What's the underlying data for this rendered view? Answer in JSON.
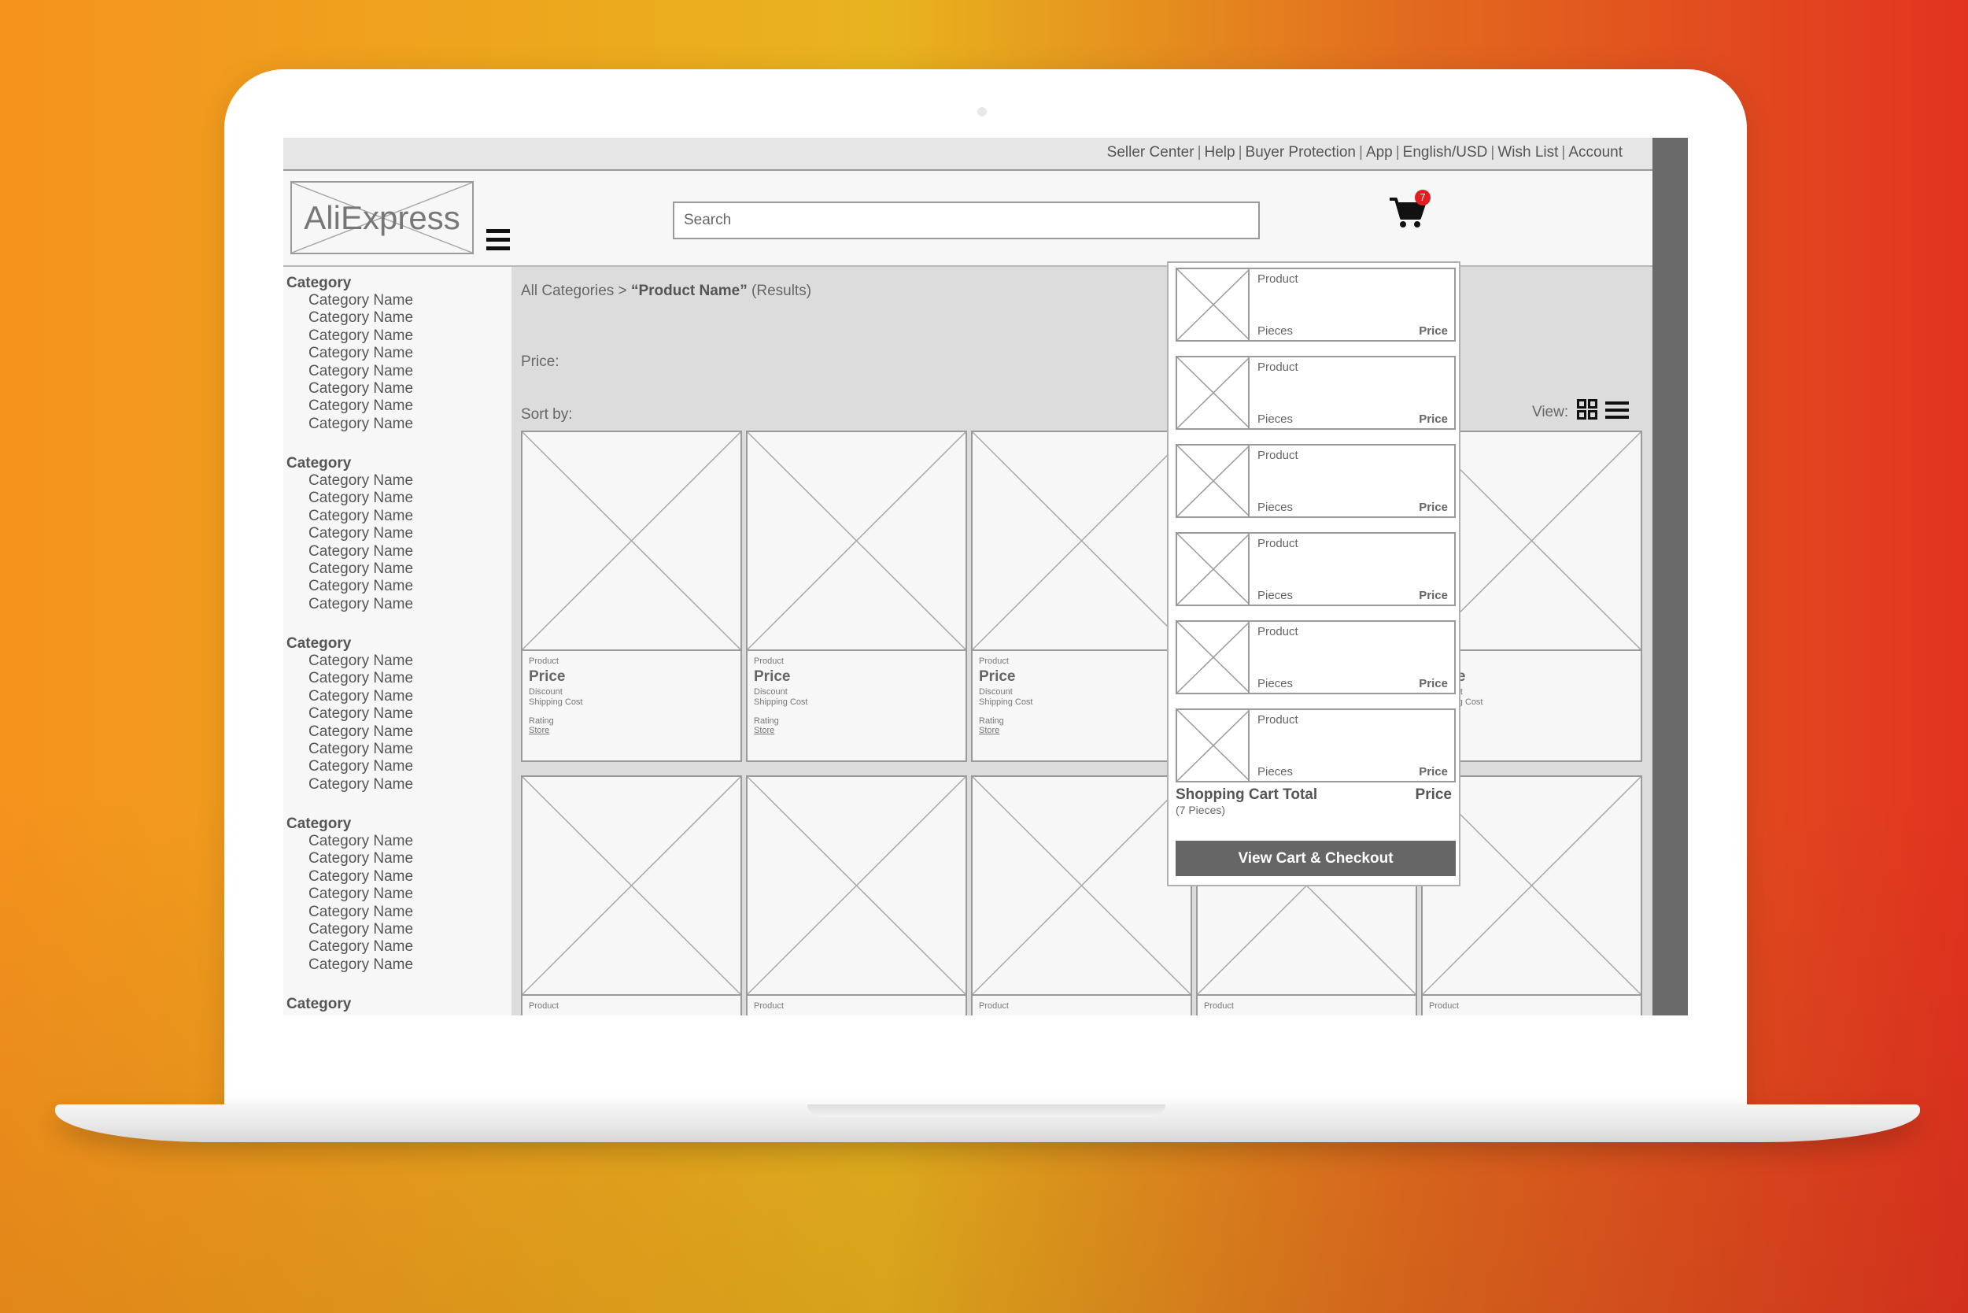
{
  "topbar": {
    "links": [
      "Seller Center",
      "Help",
      "Buyer Protection",
      "App",
      "English/USD",
      "Wish List",
      "Account"
    ],
    "separator": "|"
  },
  "header": {
    "logo_text": "AliExpress",
    "search_placeholder": "Search",
    "cart_count": "7"
  },
  "sidebar": {
    "groups": [
      {
        "title": "Category",
        "items": [
          "Category Name",
          "Category Name",
          "Category Name",
          "Category Name",
          "Category Name",
          "Category Name",
          "Category Name",
          "Category Name"
        ]
      },
      {
        "title": "Category",
        "items": [
          "Category Name",
          "Category Name",
          "Category Name",
          "Category Name",
          "Category Name",
          "Category Name",
          "Category Name",
          "Category Name"
        ]
      },
      {
        "title": "Category",
        "items": [
          "Category Name",
          "Category Name",
          "Category Name",
          "Category Name",
          "Category Name",
          "Category Name",
          "Category Name",
          "Category Name"
        ]
      },
      {
        "title": "Category",
        "items": [
          "Category Name",
          "Category Name",
          "Category Name",
          "Category Name",
          "Category Name",
          "Category Name",
          "Category Name",
          "Category Name"
        ]
      },
      {
        "title": "Category",
        "items": []
      }
    ]
  },
  "main": {
    "breadcrumb_prefix": "All Categories > ",
    "breadcrumb_product": "“Product Name”",
    "breadcrumb_suffix": " (Results)",
    "price_label": "Price:",
    "sort_label": "Sort by:",
    "view_label": "View:"
  },
  "product_card": {
    "product": "Product",
    "price": "Price",
    "discount": "Discount",
    "shipping": "Shipping Cost",
    "rating": "Rating",
    "store": "Store"
  },
  "cart_dropdown": {
    "items": [
      {
        "product": "Product",
        "pieces": "Pieces",
        "price": "Price"
      },
      {
        "product": "Product",
        "pieces": "Pieces",
        "price": "Price"
      },
      {
        "product": "Product",
        "pieces": "Pieces",
        "price": "Price"
      },
      {
        "product": "Product",
        "pieces": "Pieces",
        "price": "Price"
      },
      {
        "product": "Product",
        "pieces": "Pieces",
        "price": "Price"
      },
      {
        "product": "Product",
        "pieces": "Pieces",
        "price": "Price"
      }
    ],
    "total_label": "Shopping Cart Total",
    "total_pieces": "(7 Pieces)",
    "total_price": "Price",
    "checkout_label": "View Cart & Checkout"
  },
  "colors": {
    "background_left": "#f5931d",
    "background_right": "#e2331f",
    "badge": "#e02020",
    "checkout_button": "#666666"
  },
  "icons": [
    "cart-icon",
    "hamburger-menu-icon",
    "grid-view-icon",
    "list-view-icon",
    "image-placeholder-icon"
  ]
}
